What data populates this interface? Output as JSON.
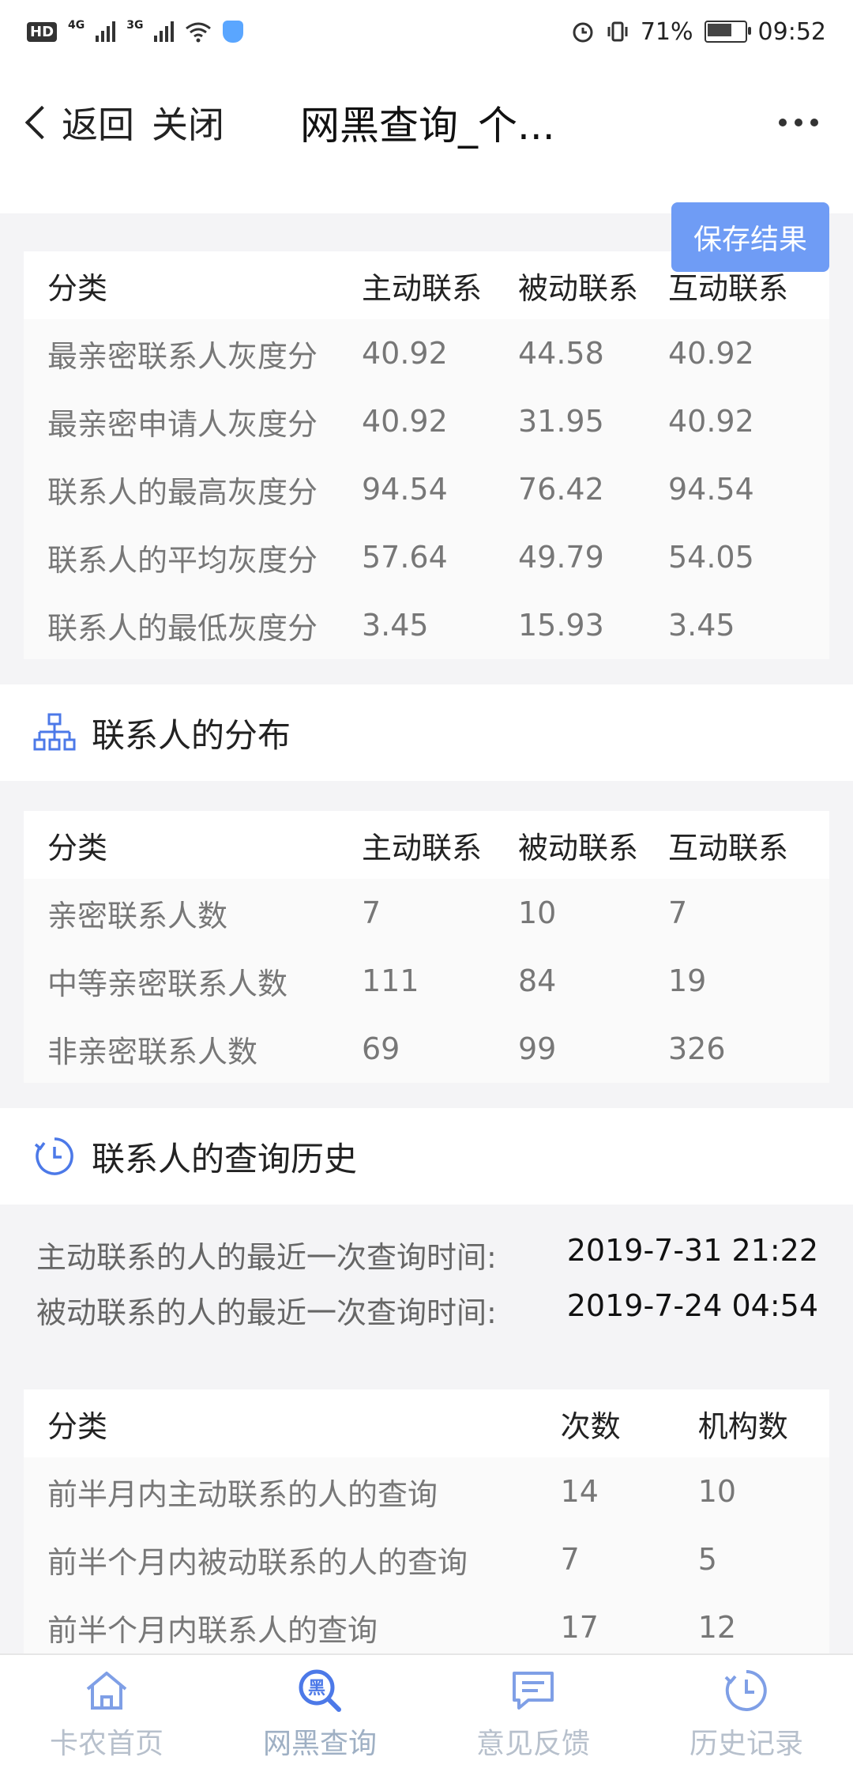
{
  "status_bar": {
    "left_badge": "HD",
    "net1": "4G",
    "net2": "3G",
    "battery_percent": "71%",
    "battery_level": 0.71,
    "time": "09:52"
  },
  "nav": {
    "back_label": "返回",
    "close_label": "关闭",
    "title": "网黑查询_个..."
  },
  "save_button": "保存结果",
  "gray_table": {
    "headers": [
      "分类",
      "主动联系",
      "被动联系",
      "互动联系"
    ],
    "rows": [
      [
        "最亲密联系人灰度分",
        "40.92",
        "44.58",
        "40.92"
      ],
      [
        "最亲密申请人灰度分",
        "40.92",
        "31.95",
        "40.92"
      ],
      [
        "联系人的最高灰度分",
        "94.54",
        "76.42",
        "94.54"
      ],
      [
        "联系人的平均灰度分",
        "57.64",
        "49.79",
        "54.05"
      ],
      [
        "联系人的最低灰度分",
        "3.45",
        "15.93",
        "3.45"
      ]
    ]
  },
  "distribution": {
    "title": "联系人的分布",
    "headers": [
      "分类",
      "主动联系",
      "被动联系",
      "互动联系"
    ],
    "rows": [
      [
        "亲密联系人数",
        "7",
        "10",
        "7"
      ],
      [
        "中等亲密联系人数",
        "111",
        "84",
        "19"
      ],
      [
        "非亲密联系人数",
        "69",
        "99",
        "326"
      ]
    ]
  },
  "query_history": {
    "title": "联系人的查询历史",
    "lines": [
      {
        "label": "主动联系的人的最近一次查询时间:",
        "value": "2019-7-31 21:22"
      },
      {
        "label": "被动联系的人的最近一次查询时间:",
        "value": "2019-7-24 04:54"
      }
    ],
    "headers": [
      "分类",
      "次数",
      "机构数"
    ],
    "rows": [
      [
        "前半月内主动联系的人的查询",
        "14",
        "10"
      ],
      [
        "前半个月内被动联系的人的查询",
        "7",
        "5"
      ],
      [
        "前半个月内联系人的查询",
        "17",
        "12"
      ]
    ]
  },
  "tabs": [
    {
      "label": "卡农首页",
      "icon": "home-icon"
    },
    {
      "label": "网黑查询",
      "icon": "blacklist-search-icon",
      "icon_char": "黑"
    },
    {
      "label": "意见反馈",
      "icon": "feedback-icon"
    },
    {
      "label": "历史记录",
      "icon": "history-icon"
    }
  ],
  "colors": {
    "accent": "#6f9cf5",
    "icon_blue": "#4c79e8",
    "tab_inactive": "#b7c0cc"
  }
}
